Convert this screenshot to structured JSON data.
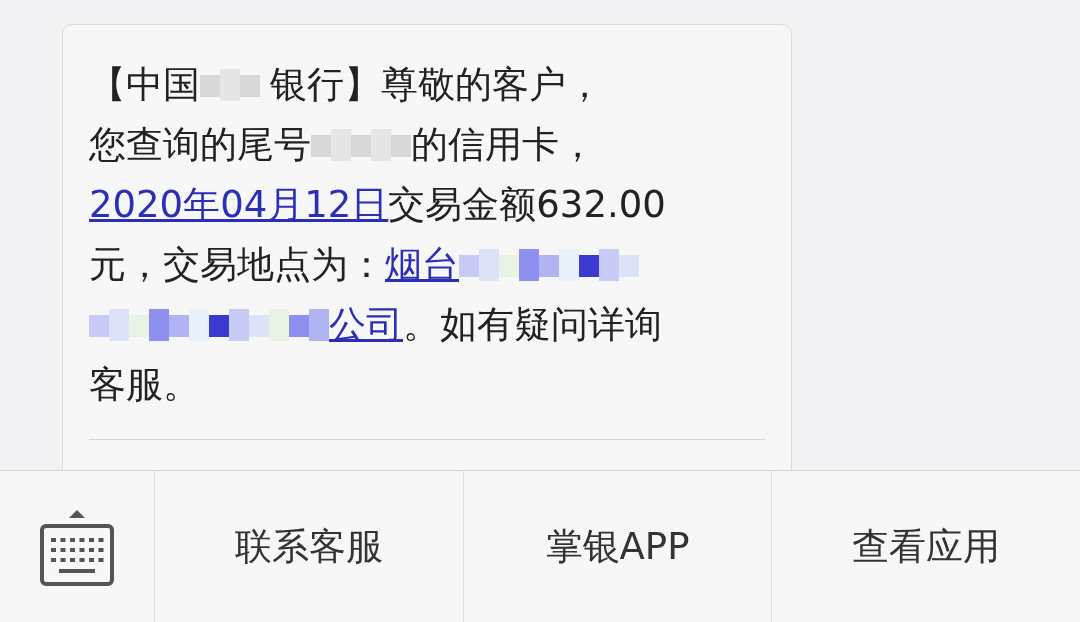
{
  "message": {
    "lines": [
      [
        {
          "kind": "text",
          "text": "【中国"
        },
        {
          "kind": "redacted",
          "in_link": false
        },
        {
          "kind": "text",
          "text": "银行】尊敬的客户，"
        }
      ],
      [
        {
          "kind": "text",
          "text": "您查询的尾号"
        },
        {
          "kind": "redacted",
          "in_link": false
        },
        {
          "kind": "text",
          "text": "的信用卡，"
        }
      ],
      [
        {
          "kind": "link",
          "text": "2020年04月12日"
        },
        {
          "kind": "text",
          "text": "交易金额632.00"
        }
      ],
      [
        {
          "kind": "text",
          "text": "元，交易地点为："
        },
        {
          "kind": "link",
          "text": "烟台"
        },
        {
          "kind": "redacted",
          "in_link": true
        }
      ],
      [
        {
          "kind": "redacted",
          "in_link": true
        },
        {
          "kind": "link",
          "text": "公司"
        },
        {
          "kind": "text",
          "text": "。如有疑问详询"
        }
      ],
      [
        {
          "kind": "text",
          "text": "客服。"
        }
      ]
    ]
  },
  "bottom_bar": {
    "buttons": [
      "联系客服",
      "掌银APP",
      "查看应用"
    ]
  }
}
